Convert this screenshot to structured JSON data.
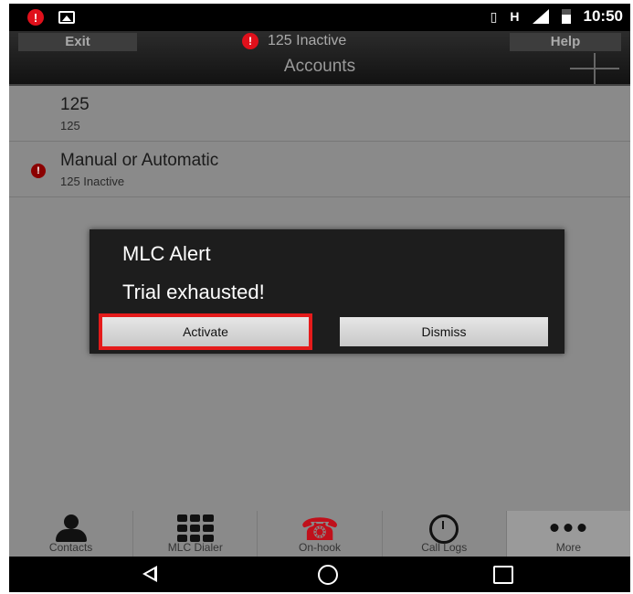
{
  "status_bar": {
    "time": "10:50",
    "network": "H"
  },
  "top_bar": {
    "exit_label": "Exit",
    "help_label": "Help",
    "status_text": "125 Inactive",
    "title": "Accounts"
  },
  "accounts": [
    {
      "name": "125",
      "sub": "125",
      "alert": false
    },
    {
      "name": "Manual or Automatic",
      "sub": "125 Inactive",
      "alert": true
    }
  ],
  "dialog": {
    "title": "MLC Alert",
    "message": "Trial exhausted!",
    "activate_label": "Activate",
    "dismiss_label": "Dismiss",
    "highlight_color": "#e51b1b"
  },
  "tabs": [
    {
      "label": "Contacts",
      "icon": "contacts-icon"
    },
    {
      "label": "MLC Dialer",
      "icon": "dialpad-icon"
    },
    {
      "label": "On-hook",
      "icon": "phone-handset-icon"
    },
    {
      "label": "Call Logs",
      "icon": "call-history-icon"
    },
    {
      "label": "More",
      "icon": "more-dots-icon"
    }
  ]
}
